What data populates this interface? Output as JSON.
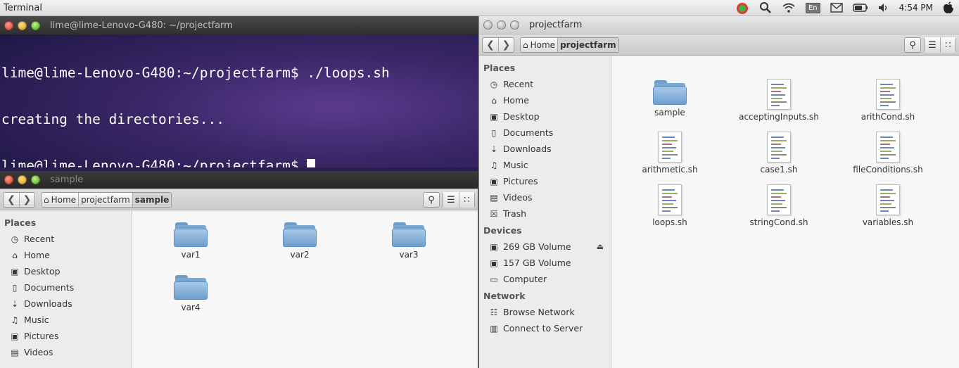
{
  "topbar": {
    "app_title": "Terminal",
    "lang": "En",
    "clock": "4:54 PM"
  },
  "terminal": {
    "title": "lime@lime-Lenovo-G480: ~/projectfarm",
    "lines": [
      "lime@lime-Lenovo-G480:~/projectfarm$ ./loops.sh",
      "creating the directories...",
      "lime@lime-Lenovo-G480:~/projectfarm$ "
    ]
  },
  "fm_left": {
    "title": "sample",
    "crumbs": [
      "Home",
      "projectfarm",
      "sample"
    ],
    "sidebar": {
      "places_header": "Places",
      "places": [
        {
          "label": "Recent",
          "icon": "clock-icon"
        },
        {
          "label": "Home",
          "icon": "home-icon"
        },
        {
          "label": "Desktop",
          "icon": "desktop-icon"
        },
        {
          "label": "Documents",
          "icon": "documents-icon"
        },
        {
          "label": "Downloads",
          "icon": "downloads-icon"
        },
        {
          "label": "Music",
          "icon": "music-icon"
        },
        {
          "label": "Pictures",
          "icon": "pictures-icon"
        },
        {
          "label": "Videos",
          "icon": "videos-icon"
        }
      ]
    },
    "items": [
      "var1",
      "var2",
      "var3",
      "var4"
    ]
  },
  "fm_right": {
    "title": "projectfarm",
    "crumbs": [
      "Home",
      "projectfarm"
    ],
    "sidebar": {
      "places_header": "Places",
      "places": [
        {
          "label": "Recent",
          "icon": "clock-icon"
        },
        {
          "label": "Home",
          "icon": "home-icon"
        },
        {
          "label": "Desktop",
          "icon": "desktop-icon"
        },
        {
          "label": "Documents",
          "icon": "documents-icon"
        },
        {
          "label": "Downloads",
          "icon": "downloads-icon"
        },
        {
          "label": "Music",
          "icon": "music-icon"
        },
        {
          "label": "Pictures",
          "icon": "pictures-icon"
        },
        {
          "label": "Videos",
          "icon": "videos-icon"
        },
        {
          "label": "Trash",
          "icon": "trash-icon"
        }
      ],
      "devices_header": "Devices",
      "devices": [
        {
          "label": "269 GB Volume",
          "icon": "drive-icon"
        },
        {
          "label": "157 GB Volume",
          "icon": "drive-icon"
        },
        {
          "label": "Computer",
          "icon": "computer-icon"
        }
      ],
      "network_header": "Network",
      "network": [
        {
          "label": "Browse Network",
          "icon": "network-icon"
        },
        {
          "label": "Connect to Server",
          "icon": "server-icon"
        }
      ]
    },
    "items": [
      {
        "label": "sample",
        "type": "folder"
      },
      {
        "label": "acceptingInputs.sh",
        "type": "script"
      },
      {
        "label": "arithCond.sh",
        "type": "script"
      },
      {
        "label": "arithmetic.sh",
        "type": "script"
      },
      {
        "label": "case1.sh",
        "type": "script"
      },
      {
        "label": "fileConditions.sh",
        "type": "script"
      },
      {
        "label": "loops.sh",
        "type": "script"
      },
      {
        "label": "stringCond.sh",
        "type": "script"
      },
      {
        "label": "variables.sh",
        "type": "script"
      }
    ]
  }
}
